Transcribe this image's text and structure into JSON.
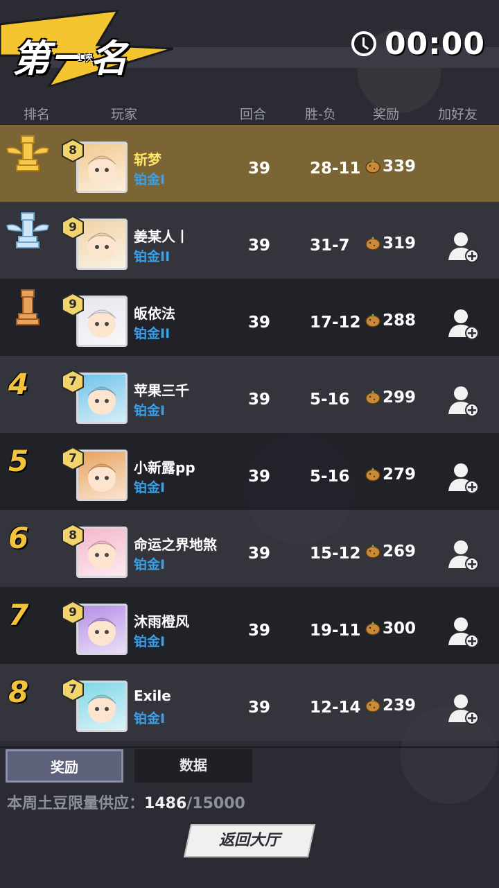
{
  "header": {
    "title": "第一名",
    "subtitle": "1快",
    "timer": "00:00"
  },
  "columns": {
    "rank": "排名",
    "player": "玩家",
    "rounds": "回合",
    "win_loss": "胜-负",
    "reward": "奖励",
    "add_friend": "加好友"
  },
  "rows": [
    {
      "rank": "1",
      "rank_style": "gold-trophy",
      "level": "8",
      "name": "斩梦",
      "tier": "铂金I",
      "rounds": "39",
      "win_loss": "28-11",
      "reward": "339",
      "avatar_color": "#f2c98e",
      "can_add": false
    },
    {
      "rank": "2",
      "rank_style": "silver-trophy",
      "level": "9",
      "name": "姜某人丨",
      "tier": "铂金II",
      "rounds": "39",
      "win_loss": "31-7",
      "reward": "319",
      "avatar_color": "#f0d3a6",
      "can_add": true
    },
    {
      "rank": "3",
      "rank_style": "bronze-trophy",
      "level": "9",
      "name": "皈依法",
      "tier": "铂金II",
      "rounds": "39",
      "win_loss": "17-12",
      "reward": "288",
      "avatar_color": "#e6e6ee",
      "can_add": true
    },
    {
      "rank": "4",
      "rank_style": "number",
      "level": "7",
      "name": "苹果三千",
      "tier": "铂金I",
      "rounds": "39",
      "win_loss": "5-16",
      "reward": "299",
      "avatar_color": "#6fc3e9",
      "can_add": true
    },
    {
      "rank": "5",
      "rank_style": "number",
      "level": "7",
      "name": "小新露pp",
      "tier": "铂金I",
      "rounds": "39",
      "win_loss": "5-16",
      "reward": "279",
      "avatar_color": "#e8a25e",
      "can_add": true
    },
    {
      "rank": "6",
      "rank_style": "number",
      "level": "8",
      "name": "命运之界地煞",
      "tier": "铂金I",
      "rounds": "39",
      "win_loss": "15-12",
      "reward": "269",
      "avatar_color": "#f4b6cc",
      "can_add": true
    },
    {
      "rank": "7",
      "rank_style": "number",
      "level": "9",
      "name": "沐雨橙风",
      "tier": "铂金I",
      "rounds": "39",
      "win_loss": "19-11",
      "reward": "300",
      "avatar_color": "#b58ee6",
      "can_add": true
    },
    {
      "rank": "8",
      "rank_style": "number",
      "level": "7",
      "name": "Exile",
      "tier": "铂金I",
      "rounds": "39",
      "win_loss": "12-14",
      "reward": "239",
      "avatar_color": "#7fd6e6",
      "can_add": true
    }
  ],
  "tabs": {
    "rewards": "奖励",
    "data": "数据"
  },
  "supply": {
    "label": "本周土豆限量供应：",
    "current": "1486",
    "separator": "/",
    "max": "15000"
  },
  "lobby_button": "返回大厅",
  "colors": {
    "gold": "#f3c33b",
    "tier_blue": "#3aa0e8",
    "highlight_row": "#7b6534"
  }
}
